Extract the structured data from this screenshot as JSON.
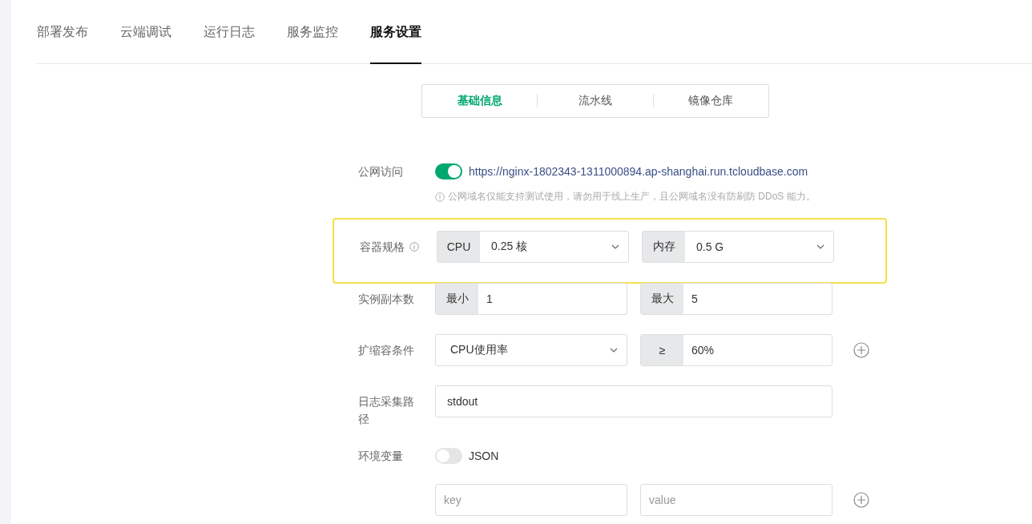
{
  "tabs": [
    {
      "label": "部署发布",
      "selected": false
    },
    {
      "label": "云端调试",
      "selected": false
    },
    {
      "label": "运行日志",
      "selected": false
    },
    {
      "label": "服务监控",
      "selected": false
    },
    {
      "label": "服务设置",
      "selected": true
    }
  ],
  "subtabs": [
    {
      "label": "基础信息",
      "selected": true
    },
    {
      "label": "流水线",
      "selected": false
    },
    {
      "label": "镜像仓库",
      "selected": false
    }
  ],
  "form": [
    {
      "kind": "switch",
      "label": "公网访问",
      "on": true,
      "link": "https://nginx-1802343-1311000894.ap-shanghai.run.tcloudbase.com",
      "hint": "公网域名仅能支持测试使用，请勿用于线上生产，且公网域名没有防刷防 DDoS 能力。"
    },
    {
      "kind": "pair",
      "label": "容器规格",
      "info": true,
      "highlighted": true,
      "fields": [
        {
          "prefix": "CPU",
          "value": "0.25 核",
          "dropdown": true
        },
        {
          "prefix": "内存",
          "value": "0.5 G",
          "dropdown": true
        }
      ]
    },
    {
      "kind": "pair",
      "label": "实例副本数",
      "fields": [
        {
          "prefix": "最小",
          "value": "1"
        },
        {
          "prefix": "最大",
          "value": "5"
        }
      ]
    },
    {
      "kind": "pair",
      "label": "扩缩容条件",
      "add": true,
      "fields": [
        {
          "value": "CPU使用率",
          "dropdown": true
        },
        {
          "prefix": "≥",
          "value": "60%"
        }
      ]
    },
    {
      "kind": "text",
      "label": "日志采集路径",
      "value": "stdout"
    },
    {
      "kind": "switch",
      "label": "环境变量",
      "on": false,
      "switch_label": "JSON"
    },
    {
      "kind": "pair",
      "add": true,
      "fields": [
        {
          "placeholder": "key"
        },
        {
          "placeholder": "value"
        }
      ]
    }
  ]
}
